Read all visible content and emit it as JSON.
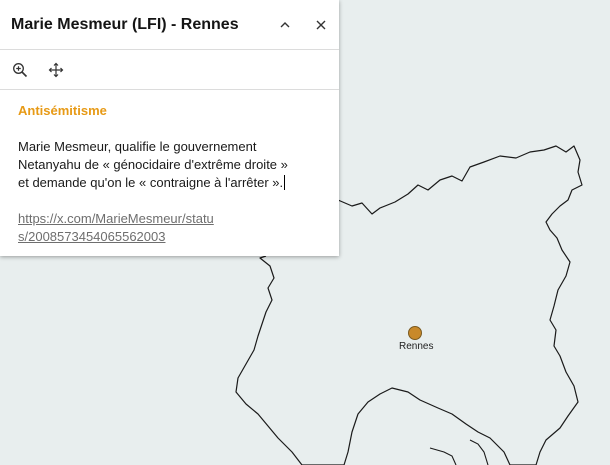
{
  "popup": {
    "title": "Marie Mesmeur (LFI) - Rennes",
    "category": "Antisémitisme",
    "description": "Marie Mesmeur, qualifie le gouvernement\nNetanyahu de « génocidaire d'extrême droite »\net demande qu'on le « contraigne à l'arrêter ».",
    "link": "https://x.com/MarieMesmeur/status/2008573454065562003",
    "category_color": "#e79a16"
  },
  "toolbar": {
    "zoom_icon": "zoom-in-icon",
    "pan_icon": "move-icon"
  },
  "header_icons": {
    "collapse": "chevron-up-icon",
    "close": "close-icon"
  },
  "map": {
    "city_label": "Rennes",
    "marker_color": "#c8892a",
    "background_color": "#e8eeee"
  }
}
